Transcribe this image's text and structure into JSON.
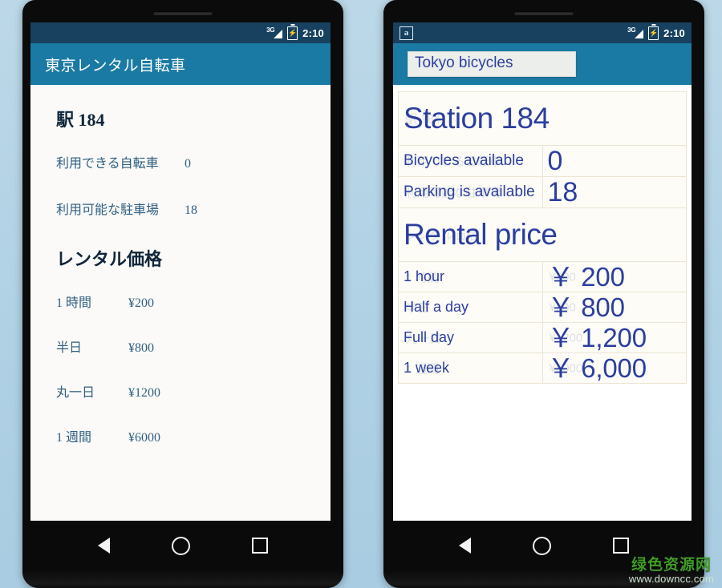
{
  "status_bar": {
    "network": "3G",
    "time": "2:10",
    "battery_icon": "battery-charging-icon",
    "signal_icon": "signal-bars-icon",
    "translate_icon": "translate-a-icon"
  },
  "left_phone": {
    "app_bar_title": "東京レンタル自転車",
    "station_heading": "駅 184",
    "info_rows": [
      {
        "label": "利用できる自転車",
        "value": "0"
      },
      {
        "label": "利用可能な駐車場",
        "value": "18"
      }
    ],
    "price_heading": "レンタル価格",
    "price_rows": [
      {
        "label": "1 時間",
        "value": "¥200"
      },
      {
        "label": "半日",
        "value": "¥800"
      },
      {
        "label": "丸一日",
        "value": "¥1200"
      },
      {
        "label": "1 週間",
        "value": "¥6000"
      }
    ]
  },
  "right_phone": {
    "overlay_title": "Tokyo bicycles",
    "overlay_title_original": "東京レンタル自転車",
    "station_heading": "Station 184",
    "station_heading_original": "駅 184",
    "info_rows": [
      {
        "label": "Bicycles available",
        "label_original": "利用できる自転車",
        "value": "0",
        "value_original": "0"
      },
      {
        "label": "Parking is available",
        "label_original": "利用可能な駐車場",
        "value": "18",
        "value_original": "18"
      }
    ],
    "price_heading": "Rental price",
    "price_heading_original": "レンタル価格",
    "price_rows": [
      {
        "label": "1 hour",
        "label_original": "1 時間",
        "value": "￥ 200",
        "value_original": "¥200"
      },
      {
        "label": "Half a day",
        "label_original": "半日",
        "value": "￥ 800",
        "value_original": "¥800"
      },
      {
        "label": "Full day",
        "label_original": "丸一日",
        "value": "￥ 1,200",
        "value_original": "¥1200"
      },
      {
        "label": "1 week",
        "label_original": "1 週間",
        "value": "￥ 6,000",
        "value_original": "¥6000"
      }
    ]
  },
  "nav_bar": {
    "back_icon": "back-triangle-icon",
    "home_icon": "home-circle-icon",
    "recents_icon": "recents-square-icon"
  },
  "watermark": {
    "site_name": "绿色资源网",
    "url": "www.downcc.com"
  },
  "colors": {
    "status_bar": "#17415f",
    "app_bar": "#1a7aa4",
    "translated_text": "#2b3e9e",
    "japanese_text": "#2f5f82",
    "backdrop": "#b4d3e5"
  }
}
